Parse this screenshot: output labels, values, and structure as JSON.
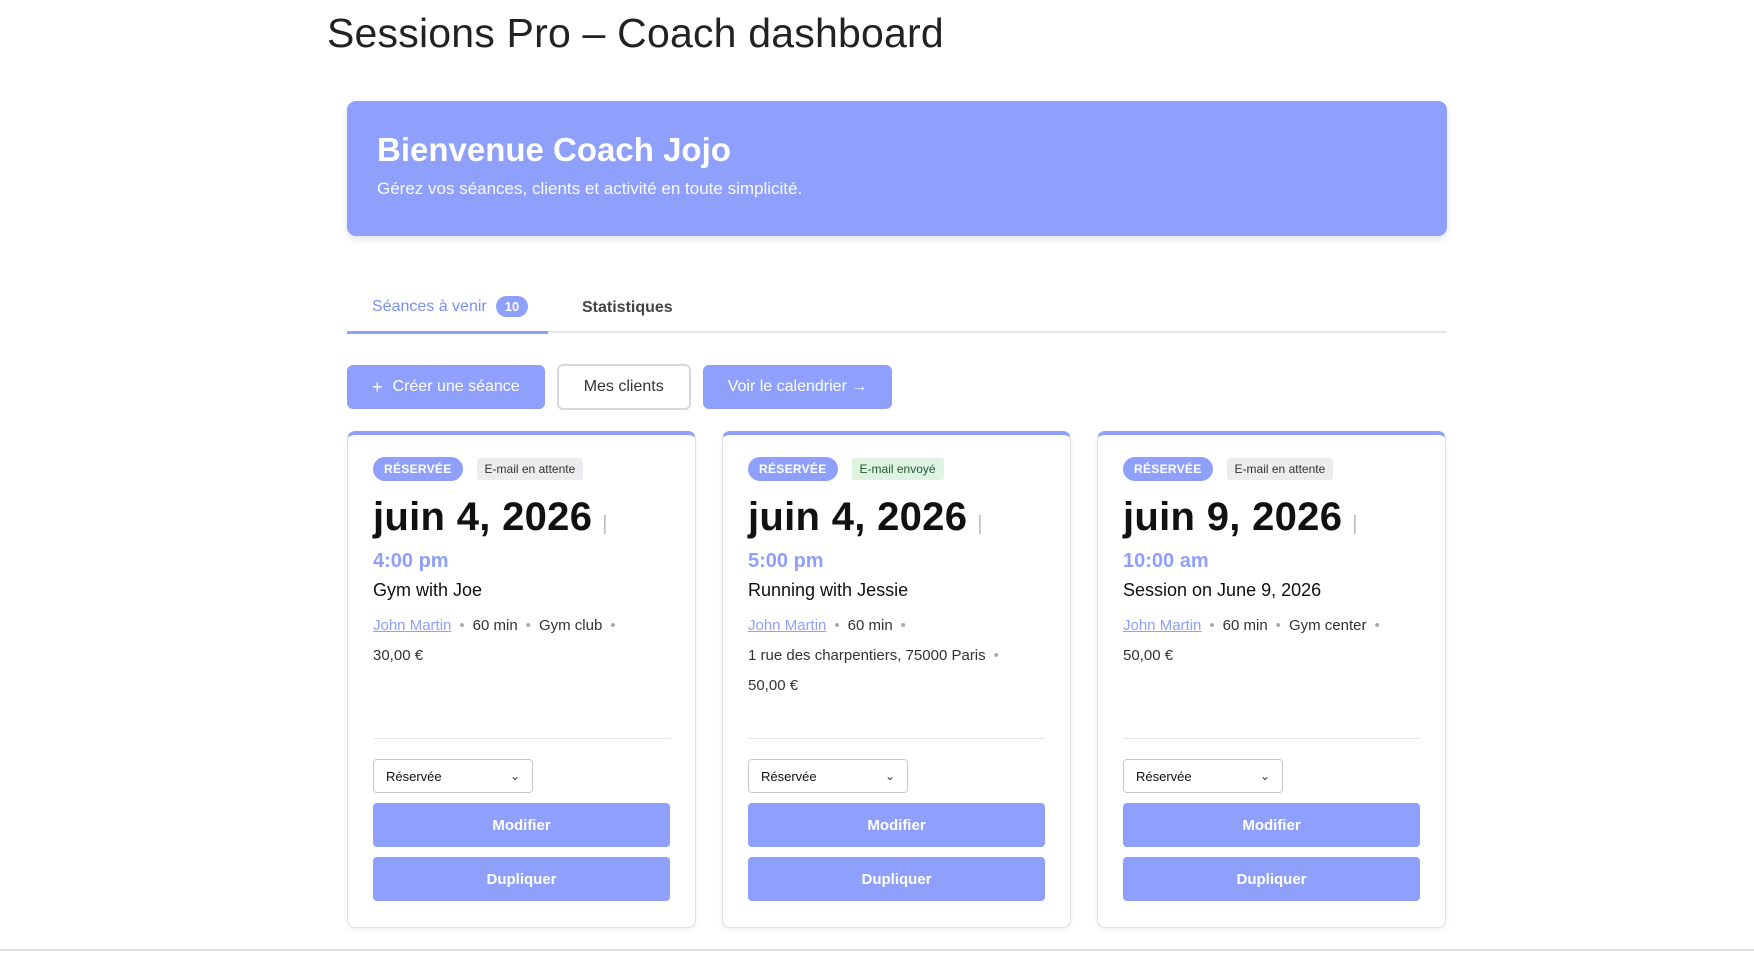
{
  "page": {
    "title": "Sessions Pro – Coach dashboard"
  },
  "hero": {
    "title": "Bienvenue Coach Jojo",
    "subtitle": "Gérez vos séances, clients et activité en toute simplicité."
  },
  "tabs": {
    "upcoming_label": "Séances à venir",
    "upcoming_count": "10",
    "stats_label": "Statistiques"
  },
  "actions": {
    "create_icon": "plus-icon",
    "create_label": "Créer une séance",
    "clients_label": "Mes clients",
    "calendar_label": "Voir le calendrier →"
  },
  "colors": {
    "accent": "#8ea0fc",
    "email_sent_bg": "#dff3e3",
    "email_pending_bg": "#ececee"
  },
  "sessions": [
    {
      "status_badge": "RÉSERVÉE",
      "email_status": "E-mail en attente",
      "date": "juin 4, 2026",
      "separator": "|",
      "time": "4:00 pm",
      "title": "Gym with Joe",
      "client": "John Martin",
      "duration": "60 min",
      "location": "Gym club",
      "price": "30,00 €",
      "select_value": "Réservée",
      "edit_label": "Modifier",
      "duplicate_label": "Dupliquer"
    },
    {
      "status_badge": "RÉSERVÉE",
      "email_status": "E-mail envoyé",
      "date": "juin 4, 2026",
      "separator": "|",
      "time": "5:00 pm",
      "title": "Running with Jessie",
      "client": "John Martin",
      "duration": "60 min",
      "location": "1 rue des charpentiers, 75000 Paris",
      "price": "50,00 €",
      "select_value": "Réservée",
      "edit_label": "Modifier",
      "duplicate_label": "Dupliquer"
    },
    {
      "status_badge": "RÉSERVÉE",
      "email_status": "E-mail en attente",
      "date": "juin 9, 2026",
      "separator": "|",
      "time": "10:00 am",
      "title": "Session on June 9, 2026",
      "client": "John Martin",
      "duration": "60 min",
      "location": "Gym center",
      "price": "50,00 €",
      "select_value": "Réservée",
      "edit_label": "Modifier",
      "duplicate_label": "Dupliquer"
    }
  ]
}
